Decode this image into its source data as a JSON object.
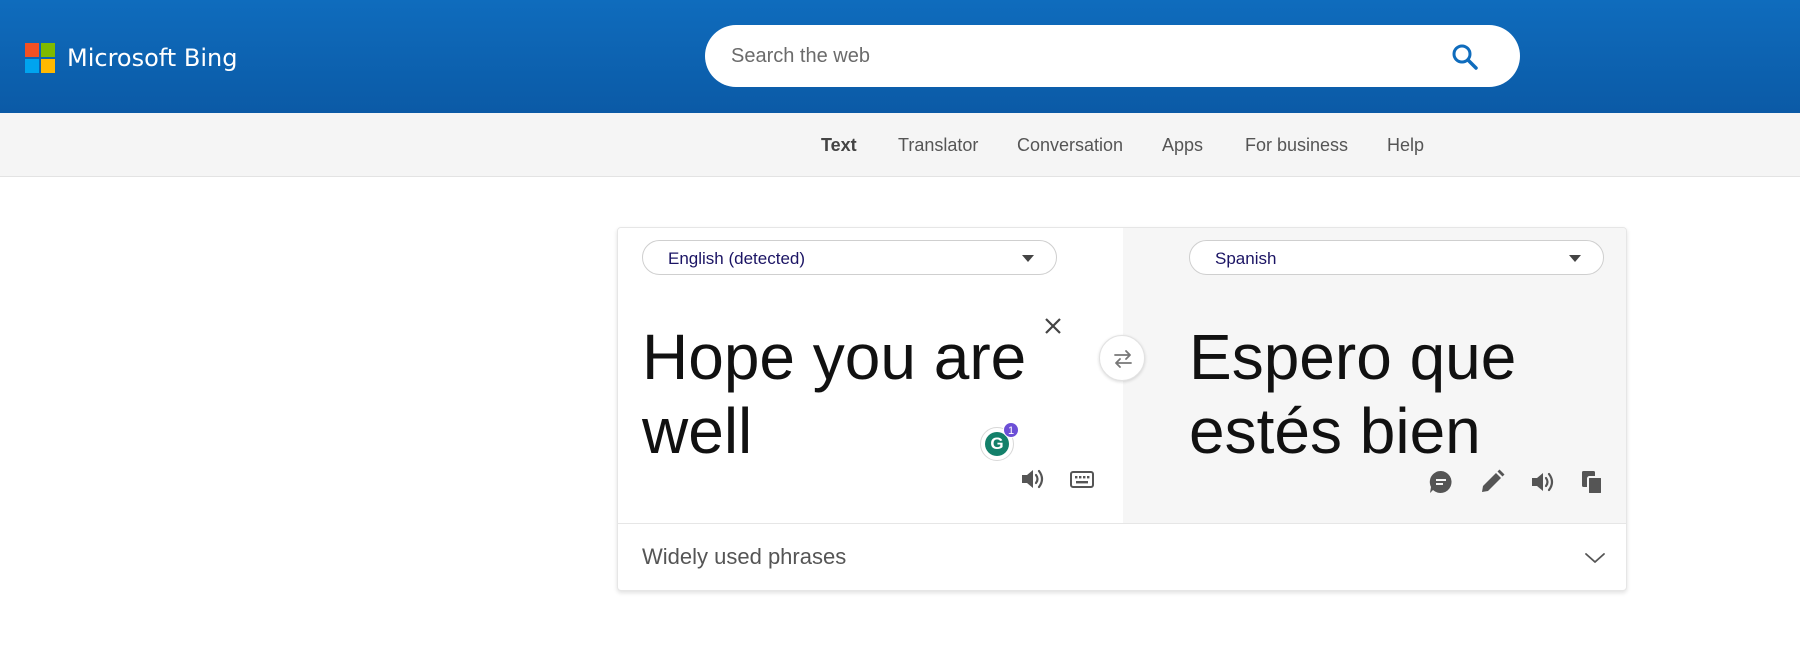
{
  "header": {
    "brand": "Microsoft Bing",
    "logo_colors": [
      "#f25022",
      "#7fba00",
      "#00a4ef",
      "#ffb900"
    ],
    "search": {
      "placeholder": "Search the web",
      "value": ""
    },
    "background": "#0f6cbd"
  },
  "nav": {
    "items": [
      {
        "label": "Text",
        "active": true
      },
      {
        "label": "Translator",
        "active": false
      },
      {
        "label": "Conversation",
        "active": false
      },
      {
        "label": "Apps",
        "active": false
      },
      {
        "label": "For business",
        "active": false
      },
      {
        "label": "Help",
        "active": false
      }
    ]
  },
  "translator": {
    "source_language": "English (detected)",
    "target_language": "Spanish",
    "source_text": {
      "line1": "Hope you are",
      "line2": "well"
    },
    "target_text": {
      "line1": "Espero que",
      "line2": "estés bien"
    },
    "grammarly": {
      "letter": "G",
      "count": "1"
    },
    "phrases_label": "Widely used phrases",
    "icons": {
      "source": [
        "close-icon",
        "speaker-icon",
        "keyboard-icon"
      ],
      "swap": "swap-icon",
      "target": [
        "feedback-icon",
        "pencil-icon",
        "speaker-icon",
        "copy-icon"
      ]
    }
  }
}
